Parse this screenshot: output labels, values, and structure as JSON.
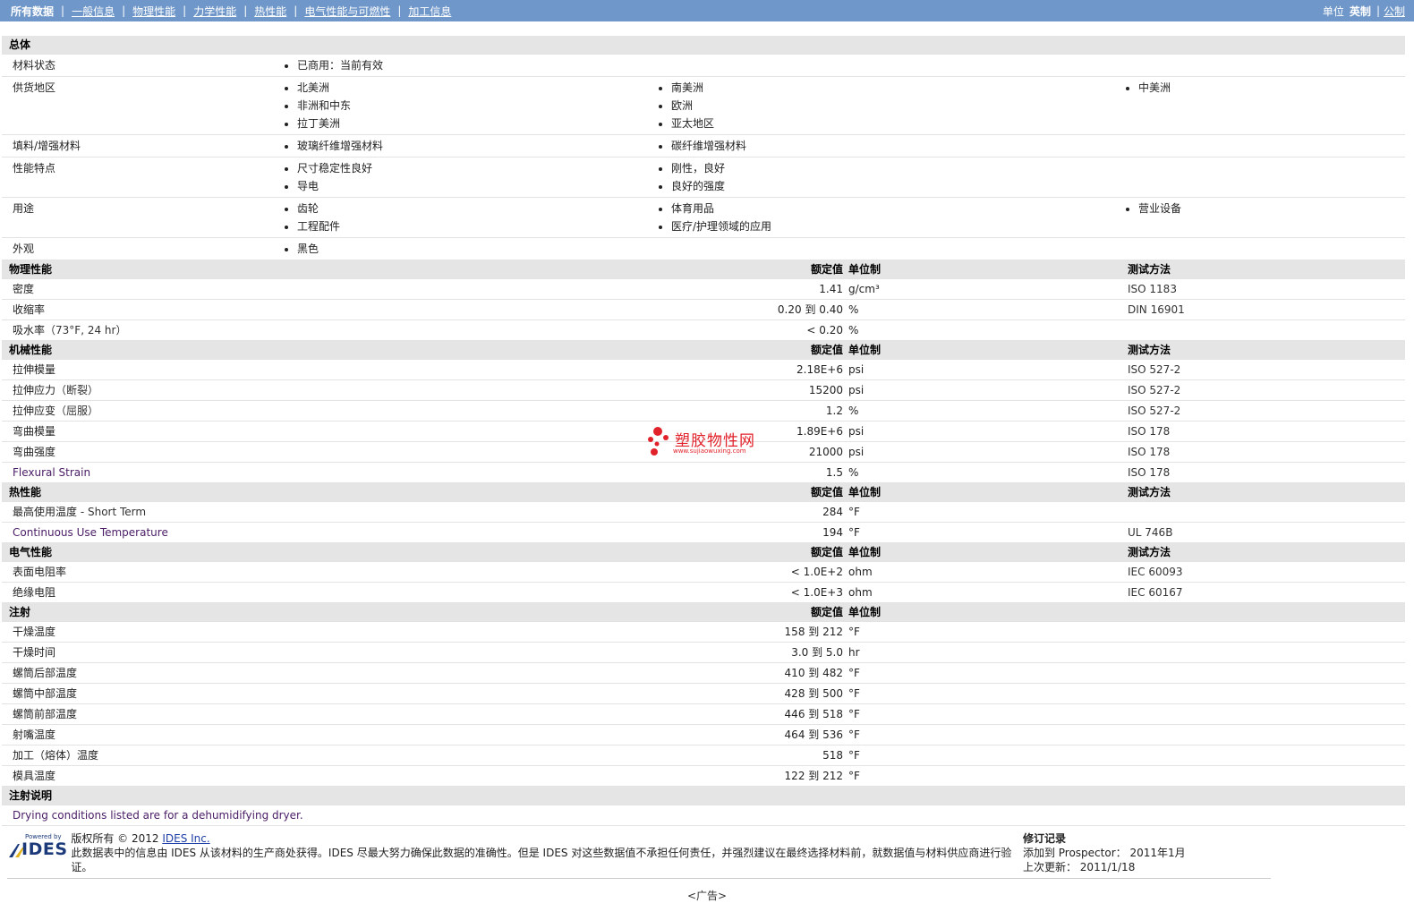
{
  "nav": {
    "tabs": [
      "所有数据",
      "一般信息",
      "物理性能",
      "力学性能",
      "热性能",
      "电气性能与可燃性",
      "加工信息"
    ],
    "units_label": "单位",
    "units_current": "英制",
    "units_other": "公制"
  },
  "general": {
    "title": "总体",
    "rows": [
      {
        "label": "材料状态",
        "cols": [
          [
            "已商用：当前有效"
          ],
          [],
          []
        ]
      },
      {
        "label": "供货地区",
        "cols": [
          [
            "北美洲",
            "非洲和中东",
            "拉丁美洲"
          ],
          [
            "南美洲",
            "欧洲",
            "亚太地区"
          ],
          [
            "中美洲"
          ]
        ]
      },
      {
        "label": "填料/增强材料",
        "cols": [
          [
            "玻璃纤维增强材料"
          ],
          [
            "碳纤维增强材料"
          ],
          []
        ]
      },
      {
        "label": "性能特点",
        "cols": [
          [
            "尺寸稳定性良好",
            "导电"
          ],
          [
            "刚性，良好",
            "良好的强度"
          ],
          []
        ]
      },
      {
        "label": "用途",
        "cols": [
          [
            "齿轮",
            "工程配件"
          ],
          [
            "体育用品",
            "医疗/护理领域的应用"
          ],
          [
            "营业设备"
          ]
        ]
      },
      {
        "label": "外观",
        "cols": [
          [
            "黑色"
          ],
          [],
          []
        ]
      }
    ]
  },
  "sections": [
    {
      "title": "物理性能",
      "nominal": "额定值",
      "unit": "单位制",
      "test": "测试方法",
      "rows": [
        {
          "label": "密度",
          "cond": "",
          "value": "1.41",
          "unit": "g/cm³",
          "test": "ISO 1183"
        },
        {
          "label": "收缩率",
          "cond": "",
          "value": "0.20 到  0.40",
          "unit": "%",
          "test": "DIN 16901"
        },
        {
          "label": "吸水率",
          "cond": "（73°F, 24 hr）",
          "value": "< 0.20",
          "unit": "%",
          "test": ""
        }
      ]
    },
    {
      "title": "机械性能",
      "nominal": "额定值",
      "unit": "单位制",
      "test": "测试方法",
      "rows": [
        {
          "label": "拉伸模量",
          "cond": "",
          "value": "2.18E+6",
          "unit": "psi",
          "test": "ISO 527-2"
        },
        {
          "label": "拉伸应力",
          "cond": "（断裂）",
          "value": "15200",
          "unit": "psi",
          "test": "ISO 527-2"
        },
        {
          "label": "拉伸应变",
          "cond": "（屈服）",
          "value": "1.2",
          "unit": "%",
          "test": "ISO 527-2"
        },
        {
          "label": "弯曲模量",
          "cond": "",
          "value": "1.89E+6",
          "unit": "psi",
          "test": "ISO 178"
        },
        {
          "label": "弯曲强度",
          "cond": "",
          "value": "21000",
          "unit": "psi",
          "test": "ISO 178"
        },
        {
          "label": "Flexural Strain",
          "cond": "",
          "value": "1.5",
          "unit": "%",
          "test": "ISO 178",
          "en": true
        }
      ]
    },
    {
      "title": "热性能",
      "nominal": "额定值",
      "unit": "单位制",
      "test": "测试方法",
      "rows": [
        {
          "label": "最高使用温度",
          "cond": " - Short Term",
          "value": "284",
          "unit": "°F",
          "test": ""
        },
        {
          "label": "Continuous Use Temperature",
          "cond": "",
          "value": "194",
          "unit": "°F",
          "test": "UL 746B",
          "en": true
        }
      ]
    },
    {
      "title": "电气性能",
      "nominal": "额定值",
      "unit": "单位制",
      "test": "测试方法",
      "rows": [
        {
          "label": "表面电阻率",
          "cond": "",
          "value": "< 1.0E+2",
          "unit": "ohm",
          "test": "IEC 60093"
        },
        {
          "label": "绝缘电阻",
          "cond": "",
          "value": "< 1.0E+3",
          "unit": "ohm",
          "test": "IEC 60167"
        }
      ]
    },
    {
      "title": "注射",
      "nominal": "额定值",
      "unit": "单位制",
      "test": "",
      "rows": [
        {
          "label": "干燥温度",
          "cond": "",
          "value": "158 到  212",
          "unit": "°F",
          "test": ""
        },
        {
          "label": "干燥时间",
          "cond": "",
          "value": "3.0 到  5.0",
          "unit": "hr",
          "test": ""
        },
        {
          "label": "螺筒后部温度",
          "cond": "",
          "value": "410 到  482",
          "unit": "°F",
          "test": ""
        },
        {
          "label": "螺筒中部温度",
          "cond": "",
          "value": "428 到  500",
          "unit": "°F",
          "test": ""
        },
        {
          "label": "螺筒前部温度",
          "cond": "",
          "value": "446 到  518",
          "unit": "°F",
          "test": ""
        },
        {
          "label": "射嘴温度",
          "cond": "",
          "value": "464 到  536",
          "unit": "°F",
          "test": ""
        },
        {
          "label": "加工（熔体）温度",
          "cond": "",
          "value": "518",
          "unit": "°F",
          "test": ""
        },
        {
          "label": "模具温度",
          "cond": "",
          "value": "122 到  212",
          "unit": "°F",
          "test": ""
        }
      ]
    }
  ],
  "notes": {
    "title": "注射说明",
    "text": "Drying conditions listed are for a dehumidifying dryer."
  },
  "footer": {
    "logo_powered": "Powered by",
    "logo_brand": "IDES",
    "copyright_prefix": "版权所有 © 2012",
    "copyright_link": "IDES Inc.",
    "disclaimer": "此数据表中的信息由 IDES 从该材料的生产商处获得。IDES 尽最大努力确保此数据的准确性。但是 IDES 对这些数据值不承担任何责任，并强烈建议在最终选择材料前，就数据值与材料供应商进行验证。",
    "rev_title": "修订记录",
    "rev_added_label": "添加到 Prospector：",
    "rev_added_value": "2011年1月",
    "rev_updated_label": "上次更新：",
    "rev_updated_value": "2011/1/18"
  },
  "ad_label": "<广告>",
  "watermark": {
    "title": "塑胶物性网",
    "url": "www.sujiaowuxing.com"
  }
}
